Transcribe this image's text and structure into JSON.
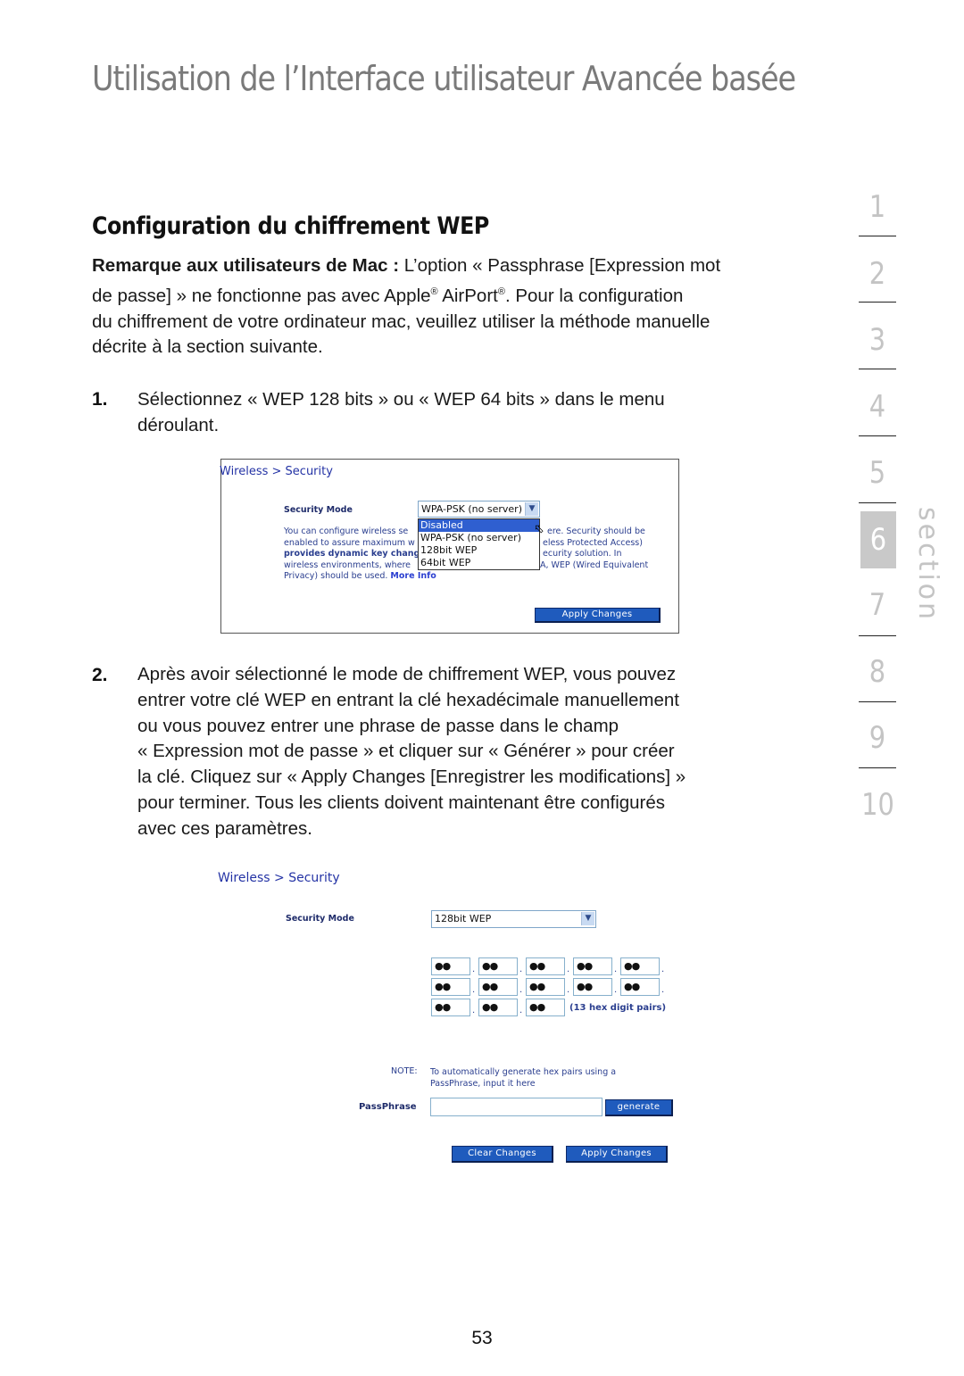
{
  "page": {
    "title": "Utilisation de l’Interface utilisateur Avancée basée",
    "heading": "Configuration du chiffrement WEP",
    "note_bold": "Remarque aux utilisateurs de Mac :",
    "note_lines": [
      " L’option « Passphrase [Expression mot",
      "de passe] » ne fonctionne pas avec Apple",
      " AirPort",
      ". Pour la configuration",
      "du chiffrement de votre ordinateur mac, veuillez utiliser la méthode manuelle",
      "décrite à la section suivante."
    ],
    "registered_mark": "®",
    "steps": [
      {
        "number": "1.",
        "lines": [
          "Sélectionnez « WEP 128 bits » ou « WEP 64 bits » dans le menu",
          "déroulant."
        ]
      },
      {
        "number": "2.",
        "lines": [
          "Après avoir sélectionné le mode de chiffrement WEP, vous pouvez",
          "entrer votre clé WEP en entrant la clé hexadécimale manuellement",
          "ou vous pouvez entrer une phrase de passe dans le champ",
          "« Expression mot de passe » et cliquer sur « Générer » pour créer",
          "la clé. Cliquez sur « Apply Changes [Enregistrer les modifications] »",
          "pour terminer. Tous les clients doivent maintenant être configurés",
          "avec ces paramètres."
        ]
      }
    ],
    "page_number": "53"
  },
  "screenshot1": {
    "breadcrumb": "Wireless > Security",
    "security_mode_label": "Security Mode",
    "security_mode_value": "WPA-PSK (no server)",
    "dropdown_options": [
      "Disabled",
      "WPA-PSK (no server)",
      "128bit WEP",
      "64bit WEP"
    ],
    "highlighted_option": "Disabled",
    "description_lines": [
      "You can configure wireless se",
      "ere. Security should be",
      "enabled to assure maximum w",
      "eless Protected Access)",
      "provides dynamic key change",
      "ecurity solution. In",
      "wireless environments, where",
      "A, WEP (Wired Equivalent",
      "Privacy) should be used."
    ],
    "more_info": "More Info",
    "apply_button": "Apply Changes"
  },
  "screenshot2": {
    "breadcrumb": "Wireless > Security",
    "security_mode_label": "Security Mode",
    "security_mode_value": "128bit WEP",
    "hex_fields": [
      "●●",
      "●●",
      "●●",
      "●●",
      "●●",
      "●●",
      "●●",
      "●●",
      "●●",
      "●●",
      "●●",
      "●●",
      "●●"
    ],
    "hex_note": "(13 hex digit pairs)",
    "note_label": "NOTE:",
    "note_text": "To automatically generate hex pairs using a PassPhrase, input it here",
    "passphrase_label": "PassPhrase",
    "passphrase_value": "",
    "generate_button": "generate",
    "clear_button": "Clear Changes",
    "apply_button": "Apply Changes"
  },
  "section_nav": {
    "numbers": [
      "1",
      "2",
      "3",
      "4",
      "5",
      "6",
      "7",
      "8",
      "9",
      "10"
    ],
    "active": "6",
    "label": "section"
  },
  "colors": {
    "button_blue": "#1f5bbd",
    "link_blue": "#2433a5",
    "nav_gray": "#c4c4c4"
  }
}
